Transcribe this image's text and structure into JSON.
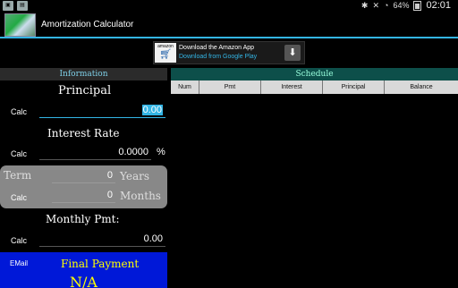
{
  "statusbar": {
    "battery": "64%",
    "time": "02:01",
    "icons": [
      "image-icon",
      "app-notification-icon",
      "bluetooth-icon",
      "mute-icon",
      "wifi-icon",
      "battery-icon"
    ]
  },
  "app": {
    "title": "Amortization Calculator"
  },
  "ad": {
    "brand": "amazon",
    "line1": "Download the Amazon App",
    "line2": "Download from Google Play",
    "download_symbol": "⬇"
  },
  "info": {
    "header": "Information",
    "principal_label": "Principal",
    "principal_calc": "Calc",
    "principal_value": "0.00",
    "rate_label": "Interest Rate",
    "rate_calc": "Calc",
    "rate_value": "0.0000",
    "rate_unit": "%",
    "term_label": "Term",
    "years_value": "0",
    "years_label": "Years",
    "months_calc": "Calc",
    "months_value": "0",
    "months_label": "Months",
    "monthly_label": "Monthly Pmt:",
    "monthly_calc": "Calc",
    "monthly_value": "0.00",
    "email_label": "EMail",
    "final_label": "Final Payment",
    "final_value": "N/A"
  },
  "schedule": {
    "header": "Schedule",
    "columns": [
      "Num",
      "Pmt",
      "Interest",
      "Principal",
      "Balance"
    ]
  },
  "colors": {
    "accent": "#33b5e5",
    "final_bg": "#0018d8",
    "final_text": "#ffff00",
    "schedule_header_bg": "#0d4f4a"
  }
}
